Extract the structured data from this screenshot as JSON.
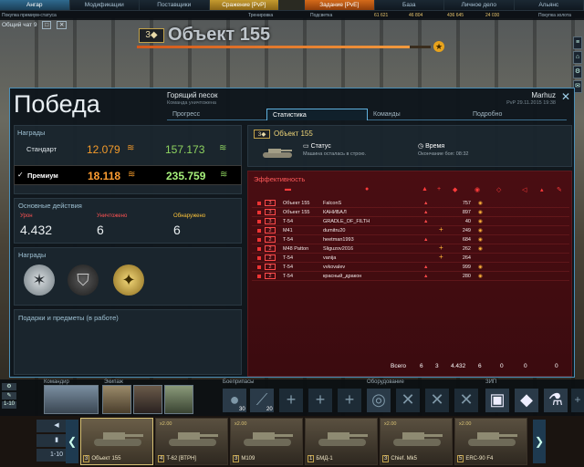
{
  "topbar": {
    "tabs": [
      "Ангар",
      "Модификации",
      "Поставщики",
      "Сражение [PvP]",
      "",
      "Задание [PvE]",
      "База",
      "Личное дело",
      "Альянс"
    ],
    "sub_left": "Покупка премиум-статуса",
    "sub_resources": [
      "61 621",
      "46 804",
      "436 645",
      "24 030",
      "24 830"
    ],
    "sub_center": [
      "Тренировка",
      "Подсветка"
    ],
    "sub_right": "Покупка золота"
  },
  "chat": {
    "label": "Общий чат 9"
  },
  "vehicle": {
    "tier": "3",
    "name": "Объект 155",
    "xp_progress": 0.93
  },
  "side_icons": [
    "≡",
    "⌂",
    "⚙",
    "✉"
  ],
  "dialog": {
    "title": "Победа",
    "map": "Горящий песок",
    "mode": "Команда уничтожена",
    "player": "Marhuz",
    "date": "PvP 29.11.2015 19:38",
    "tabs": [
      "Прогресс",
      "Статистика",
      "Команды",
      "Подробно"
    ],
    "active_tab": 1
  },
  "rewards": {
    "section": "Награды",
    "standard_label": "Стандарт",
    "standard_xp": "12.079",
    "standard_credits": "157.173",
    "premium_label": "Премиум",
    "premium_xp": "18.118",
    "premium_credits": "235.759"
  },
  "actions": {
    "section": "Основные действия",
    "damage_label": "Урон",
    "damage_value": "4.432",
    "kills_label": "Уничтожено",
    "kills_value": "6",
    "spotted_label": "Обнаружено",
    "spotted_value": "6"
  },
  "awards": {
    "section": "Награды"
  },
  "gifts": {
    "section": "Подарки и предметы (в работе)"
  },
  "summary": {
    "tier": "3",
    "name": "Объект 155",
    "status_label": "Статус",
    "status_text": "Машина осталась в строю.",
    "time_label": "Время",
    "time_text": "Окончание боя: 08:32"
  },
  "efficiency": {
    "title": "Эффективность",
    "rows": [
      {
        "tier": "3",
        "vehicle": "Объект 155",
        "player": "FalconS",
        "kill": "▲",
        "assist": "",
        "damage": "757",
        "spot": "◉"
      },
      {
        "tier": "3",
        "vehicle": "Объект 155",
        "player": "КАНИБАЛ",
        "kill": "▲",
        "assist": "",
        "damage": "897",
        "spot": "◉"
      },
      {
        "tier": "3",
        "vehicle": "T-54",
        "player": "GRADLE_OF_FILTH",
        "kill": "▲",
        "assist": "",
        "damage": "40",
        "spot": "◉"
      },
      {
        "tier": "2",
        "vehicle": "M41",
        "player": "dumitru20",
        "kill": "",
        "assist": "+",
        "damage": "249",
        "spot": "◉"
      },
      {
        "tier": "2",
        "vehicle": "T-54",
        "player": "heetman1993",
        "kill": "▲",
        "assist": "",
        "damage": "684",
        "spot": "◉"
      },
      {
        "tier": "2",
        "vehicle": "M48 Patton",
        "player": "Sliguzov2016",
        "kill": "",
        "assist": "+",
        "damage": "262",
        "spot": "◉"
      },
      {
        "tier": "2",
        "vehicle": "T-54",
        "player": "vanija",
        "kill": "",
        "assist": "+",
        "damage": "264",
        "spot": ""
      },
      {
        "tier": "2",
        "vehicle": "T-54",
        "player": "vvkovalev",
        "kill": "▲",
        "assist": "",
        "damage": "999",
        "spot": "◉"
      },
      {
        "tier": "2",
        "vehicle": "T-54",
        "player": "красный_дракон",
        "kill": "▲",
        "assist": "",
        "damage": "280",
        "spot": "◉"
      }
    ],
    "totals_label": "Всего",
    "totals": [
      "6",
      "3",
      "4.432",
      "6",
      "0",
      "0",
      "0"
    ]
  },
  "crew": {
    "commander_label": "Командир",
    "crew_label": "Экипаж",
    "ammo_label": "Боеприпасы",
    "ammo_counts": [
      "30",
      "20"
    ],
    "equipment_label": "Оборудование",
    "consumables_label": "ЗИП",
    "side_counts": [
      "1-10"
    ]
  },
  "carousel": {
    "left": [
      "◀",
      "▮",
      "1-10"
    ],
    "vehicles": [
      {
        "tier": "3",
        "name": "Объект 155",
        "xp": "",
        "selected": true
      },
      {
        "tier": "4",
        "name": "T-62 [ВТРН]",
        "xp": "x2.00",
        "selected": false
      },
      {
        "tier": "3",
        "name": "M109",
        "xp": "x2.00",
        "selected": false
      },
      {
        "tier": "1",
        "name": "БМД-1",
        "xp": "",
        "selected": false
      },
      {
        "tier": "3",
        "name": "Chief. Mk5",
        "xp": "x2.00",
        "selected": false
      },
      {
        "tier": "5",
        "name": "ERC-90 F4",
        "xp": "x2.00",
        "selected": false
      }
    ]
  }
}
